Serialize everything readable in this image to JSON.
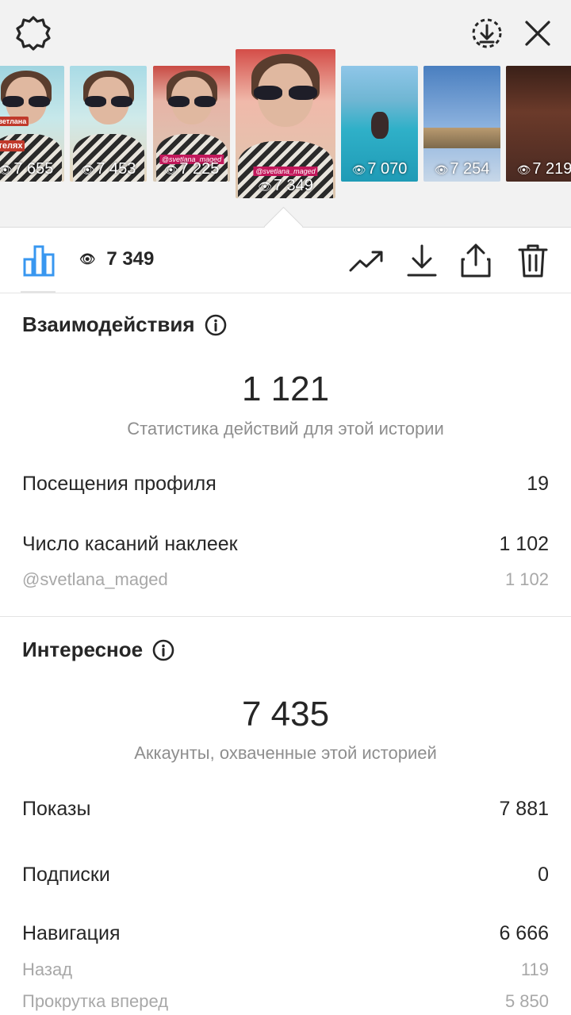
{
  "thumbnails": [
    {
      "views": "7 655",
      "caption": "Светлана",
      "caption2": "отелях"
    },
    {
      "views": "7 453"
    },
    {
      "views": "7 225",
      "tag": "@svetlana_maged"
    },
    {
      "views": "7 349",
      "tag": "@svetlana_maged",
      "selected": true
    },
    {
      "views": "7 070"
    },
    {
      "views": "7 254"
    },
    {
      "views": "7 219"
    }
  ],
  "toolbar": {
    "views": "7 349",
    "icons": [
      "bar-chart-icon",
      "eye-icon",
      "trend-icon",
      "download-icon",
      "share-icon",
      "trash-icon"
    ]
  },
  "interactions": {
    "title": "Взаимодействия",
    "total": "1 121",
    "subtitle": "Статистика действий для этой истории",
    "profile_visits_label": "Посещения профиля",
    "profile_visits_value": "19",
    "sticker_taps_label": "Число касаний наклеек",
    "sticker_taps_value": "1 102",
    "sticker_handle_label": "@svetlana_maged",
    "sticker_handle_value": "1 102"
  },
  "discovery": {
    "title": "Интересное",
    "total": "7 435",
    "subtitle": "Аккаунты, охваченные этой историей",
    "impressions_label": "Показы",
    "impressions_value": "7 881",
    "follows_label": "Подписки",
    "follows_value": "0",
    "navigation_label": "Навигация",
    "navigation_value": "6 666",
    "back_label": "Назад",
    "back_value": "119",
    "forward_label": "Прокрутка вперед",
    "forward_value": "5 850"
  },
  "colors": {
    "accent": "#3897f0",
    "text": "#262626",
    "muted": "#8e8e8e",
    "background_top": "#f2f2f2"
  }
}
